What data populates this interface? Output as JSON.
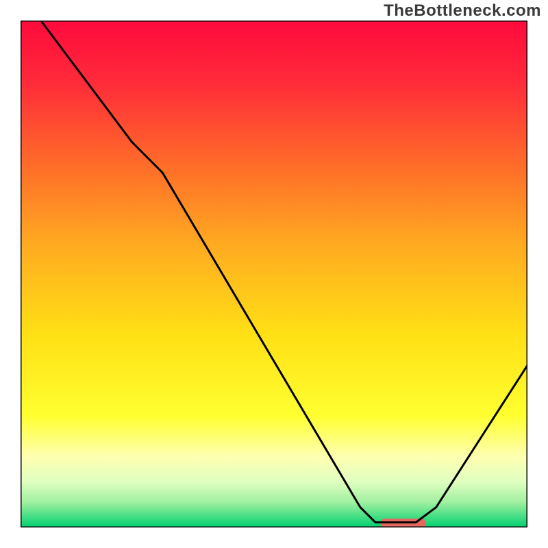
{
  "watermark": "TheBottleneck.com",
  "chart_data": {
    "type": "line",
    "title": "",
    "xlabel": "",
    "ylabel": "",
    "xlim": [
      0,
      100
    ],
    "ylim": [
      0,
      100
    ],
    "gradient_stops": [
      {
        "offset": 0.0,
        "color": "#ff0a3c"
      },
      {
        "offset": 0.12,
        "color": "#ff2a3a"
      },
      {
        "offset": 0.28,
        "color": "#ff6a2a"
      },
      {
        "offset": 0.45,
        "color": "#ffad20"
      },
      {
        "offset": 0.62,
        "color": "#ffe015"
      },
      {
        "offset": 0.78,
        "color": "#ffff30"
      },
      {
        "offset": 0.86,
        "color": "#feffb0"
      },
      {
        "offset": 0.91,
        "color": "#e0ffc0"
      },
      {
        "offset": 0.95,
        "color": "#a0f0a0"
      },
      {
        "offset": 1.0,
        "color": "#00d070"
      }
    ],
    "series": [
      {
        "name": "bottleneck-curve",
        "color": "#000000",
        "points": [
          {
            "x": 4,
            "y": 100
          },
          {
            "x": 22,
            "y": 76
          },
          {
            "x": 28,
            "y": 70
          },
          {
            "x": 67,
            "y": 4
          },
          {
            "x": 70,
            "y": 1
          },
          {
            "x": 78,
            "y": 1
          },
          {
            "x": 82,
            "y": 4
          },
          {
            "x": 100,
            "y": 32
          }
        ]
      }
    ],
    "marker": {
      "name": "highlight-marker",
      "x_start": 71,
      "x_end": 80,
      "y": 0.8,
      "color": "#e6675f"
    }
  }
}
